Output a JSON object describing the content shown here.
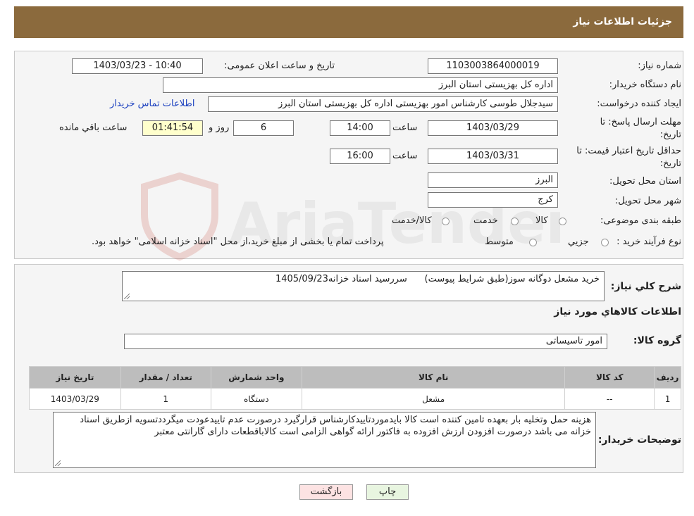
{
  "header": {
    "title": "جزئیات اطلاعات نیاز"
  },
  "fields": {
    "need_number_label": "شماره نیاز:",
    "need_number": "1103003864000019",
    "announce_label": "تاریخ و ساعت اعلان عمومی:",
    "announce_value": "1403/03/23 - 10:40",
    "buyer_label": "نام دستگاه خریدار:",
    "buyer_value": "اداره کل بهزیستی استان البرز",
    "creator_label": "ایجاد کننده درخواست:",
    "creator_value": "سیدجلال طوسی کارشناس امور بهزیستی اداره کل بهزیستی استان البرز",
    "contact_link": "اطلاعات تماس خریدار",
    "deadline_label_1": "مهلت ارسال پاسخ: تا",
    "deadline_label_2": "تاریخ:",
    "deadline_date": "1403/03/29",
    "time_label": "ساعت",
    "deadline_time": "14:00",
    "days_value": "6",
    "days_label": "روز و",
    "remaining_value": "01:41:54",
    "remaining_label": "ساعت باقي مانده",
    "validity_label_1": "حداقل تاریخ اعتبار قیمت: تا",
    "validity_label_2": "تاریخ:",
    "validity_date": "1403/03/31",
    "validity_time": "16:00",
    "province_label": "استان محل تحویل:",
    "province_value": "البرز",
    "city_label": "شهر محل تحویل:",
    "city_value": "کرج",
    "category_label": "طبقه بندی موضوعی:",
    "category_options": [
      "کالا",
      "خدمت",
      "کالا/خدمت"
    ],
    "process_label": "نوع فرآیند خرید :",
    "process_options": [
      "جزیي",
      "متوسط"
    ],
    "process_note": "پرداخت تمام یا بخشی از مبلغ خرید،از محل \"اسناد خزانه اسلامی\" خواهد بود."
  },
  "details": {
    "summary_label": "شرح كلي نياز:",
    "summary_value": "خرید مشعل دوگانه سوز(طبق شرایط پیوست)      سررسید اسناد خزانه1405/09/23",
    "goods_heading": "اطلاعات كالاهاي مورد نياز",
    "group_label": "گروه کالا:",
    "group_value": "امور تاسیساتی",
    "table": {
      "headers": [
        "رديف",
        "کد کالا",
        "نام کالا",
        "واحد شمارش",
        "تعداد / مقدار",
        "تاريخ نياز"
      ],
      "rows": [
        [
          "1",
          "--",
          "مشعل",
          "دستگاه",
          "1",
          "1403/03/29"
        ]
      ]
    },
    "notes_label": "توضیحات خریدار:",
    "notes_value": "هزینه حمل وتخلیه بار بعهده تامین کننده است کالا بایدموردتاییدکارشناس قرارگیرد درصورت عدم تاییدعودت میگرددتسویه ازطریق اسناد خزانه می باشد درصورت افزودن ارزش افزوده به فاکتور ارائه گواهی الزامی است کالاباقطعات دارای گارانتی معتبر"
  },
  "buttons": {
    "print": "چاپ",
    "back": "بازگشت"
  },
  "watermark": {
    "text": "AriaTender.neT"
  },
  "colors": {
    "header_bg": "#8b6a3d",
    "table_header_bg": "#bdbdbd",
    "remaining_bg": "#ffffcc",
    "back_btn_bg": "#fde3e3",
    "print_btn_bg": "#e8f5e0"
  }
}
